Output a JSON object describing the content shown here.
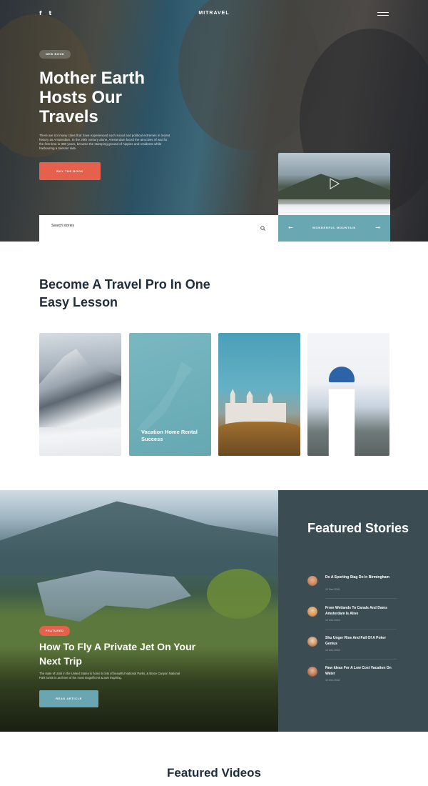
{
  "header": {
    "brand": "MITRAVEL",
    "social": [
      {
        "icon": "facebook-icon",
        "glyph": "f"
      },
      {
        "icon": "twitter-icon",
        "glyph": "t"
      }
    ]
  },
  "hero": {
    "badge": "NEW BOOK",
    "title": "Mother Earth Hosts Our Travels",
    "description": "There are not many cities that have experienced such social and political extremes in recent history as Amsterdam. In the 20th century alone, Amsterdam faced the atrocities of war for the first time in 300 years, became the stamping ground of hippies and residents while harbouring a tolerant side.",
    "button": "BUY THE BOOK"
  },
  "search": {
    "placeholder": "Search stories"
  },
  "video": {
    "label": "WONDERFUL MOUNTAIN"
  },
  "lessons": {
    "title": "Become A Travel Pro In One Easy Lesson",
    "cards": [
      {
        "caption": ""
      },
      {
        "caption": "Vacation Home Rental Success"
      },
      {
        "caption": ""
      },
      {
        "caption": ""
      }
    ]
  },
  "featured_article": {
    "tag": "FEATURED",
    "title": "How To Fly A Private Jet On Your Next Trip",
    "description": "The state of Utah in the United States is home to lots of beautiful National Parks, & Bryce Canyon National Park ranks in as three of the most magnificent & awe inspiring.",
    "button": "READ ARTICLE"
  },
  "featured_stories": {
    "title": "Featured Stories",
    "items": [
      {
        "title": "Do A Sporting Stag Do In Birmingham",
        "date": "12 Dec 2018"
      },
      {
        "title": "From Wetlands To Canals And Dams Amsterdam Is Alive",
        "date": "12 Dec 2018"
      },
      {
        "title": "Shu Unger Rise And Fall Of A Poker Genius",
        "date": "12 Dec 2018"
      },
      {
        "title": "New Ideas For A Low Cost Vacation On Water",
        "date": "12 Dec 2018"
      }
    ]
  },
  "videos": {
    "title": "Featured Videos"
  },
  "colors": {
    "accent": "#e5604d",
    "teal": "#69a8b3",
    "dark_panel": "#3b4c53",
    "heading": "#1f2d3a"
  }
}
